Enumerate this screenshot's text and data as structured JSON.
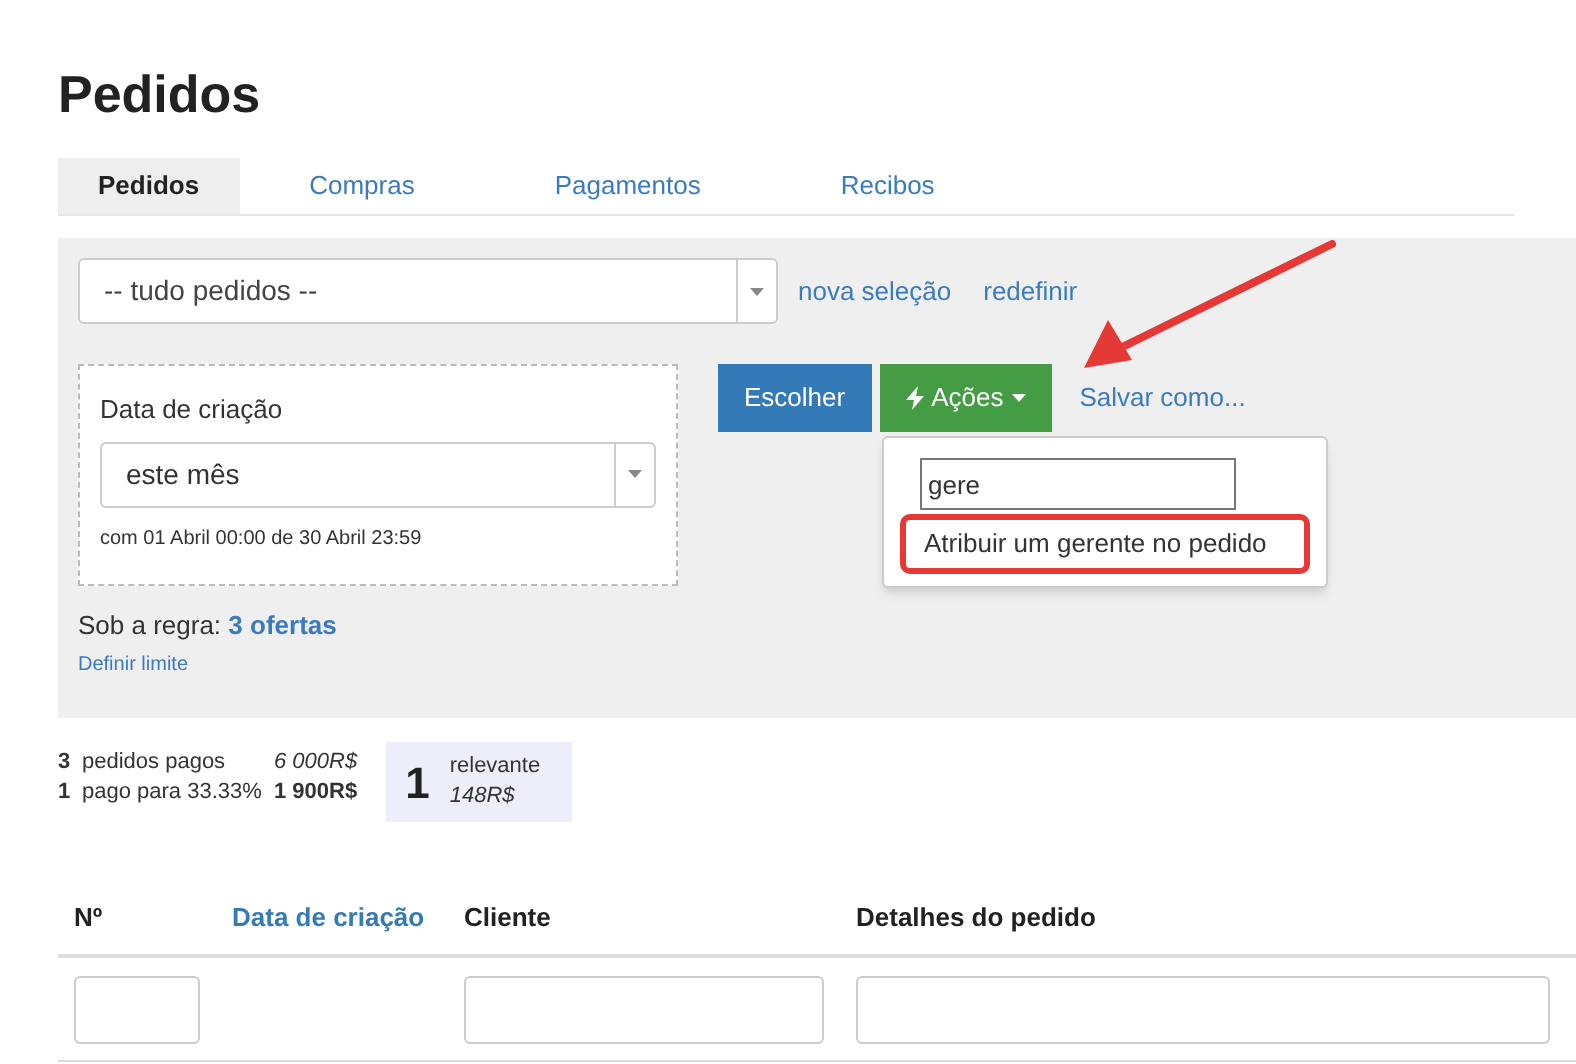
{
  "title": "Pedidos",
  "tabs": [
    {
      "label": "Pedidos",
      "selected": true
    },
    {
      "label": "Compras",
      "selected": false
    },
    {
      "label": "Pagamentos",
      "selected": false
    },
    {
      "label": "Recibos",
      "selected": false
    }
  ],
  "filter": {
    "select_value": "-- tudo pedidos --",
    "links": [
      "nova seleção",
      "redefinir"
    ]
  },
  "date_filter": {
    "label": "Data de criação",
    "value": "este mês",
    "range": "com 01 Abril 00:00 de 30 Abril 23:59"
  },
  "rule": {
    "label": "Sob a regra:",
    "link": "3 ofertas",
    "limit_link": "Definir limite"
  },
  "buttons": {
    "choose": "Escolher",
    "actions": "Ações",
    "save": "Salvar como..."
  },
  "actions_menu": {
    "search_value": "gere",
    "items": [
      {
        "label": "Atribuir um gerente no pedido",
        "highlighted": true
      }
    ]
  },
  "stats": [
    {
      "count": "3",
      "label": "pedidos pagos",
      "amount": "6 000R$",
      "kind": "total"
    },
    {
      "count": "1",
      "label": "pago para 33.33%",
      "amount": "1 900R$",
      "kind": "paid"
    }
  ],
  "relevant": {
    "count": "1",
    "label": "relevante",
    "amount": "148R$"
  },
  "table": {
    "columns": [
      {
        "label": "Nº",
        "sortable": false,
        "filter": true
      },
      {
        "label": "Data de criação",
        "sortable": true,
        "filter": false
      },
      {
        "label": "Cliente",
        "sortable": false,
        "filter": true
      },
      {
        "label": "Detalhes do pedido",
        "sortable": false,
        "filter": true
      }
    ]
  }
}
